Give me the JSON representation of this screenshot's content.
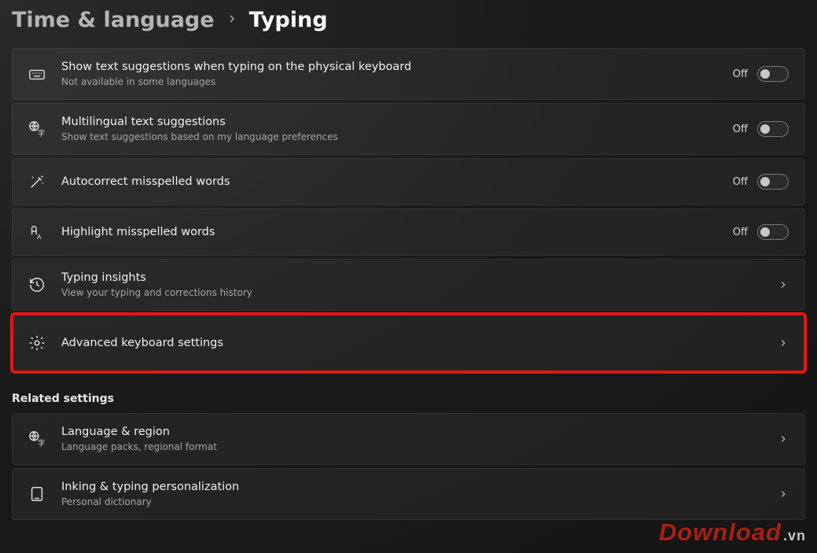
{
  "breadcrumb": {
    "parent": "Time & language",
    "current": "Typing"
  },
  "off_label": "Off",
  "rows": [
    {
      "icon": "keyboard",
      "title": "Show text suggestions when typing on the physical keyboard",
      "desc": "Not available in some languages",
      "tail": "toggle"
    },
    {
      "icon": "globe-a",
      "title": "Multilingual text suggestions",
      "desc": "Show text suggestions based on my language preferences",
      "tail": "toggle"
    },
    {
      "icon": "wand",
      "title": "Autocorrect misspelled words",
      "desc": "",
      "tail": "toggle"
    },
    {
      "icon": "spellcheck",
      "title": "Highlight misspelled words",
      "desc": "",
      "tail": "toggle"
    },
    {
      "icon": "history",
      "title": "Typing insights",
      "desc": "View your typing and corrections history",
      "tail": "nav"
    },
    {
      "icon": "gear",
      "title": "Advanced keyboard settings",
      "desc": "",
      "tail": "nav",
      "highlight": true
    }
  ],
  "related_heading": "Related settings",
  "related": [
    {
      "icon": "globe-a",
      "title": "Language & region",
      "desc": "Language packs, regional format",
      "tail": "nav"
    },
    {
      "icon": "tablet",
      "title": "Inking & typing personalization",
      "desc": "Personal dictionary",
      "tail": "nav"
    }
  ],
  "watermark": {
    "main": "Download",
    "suffix": ".vn"
  }
}
